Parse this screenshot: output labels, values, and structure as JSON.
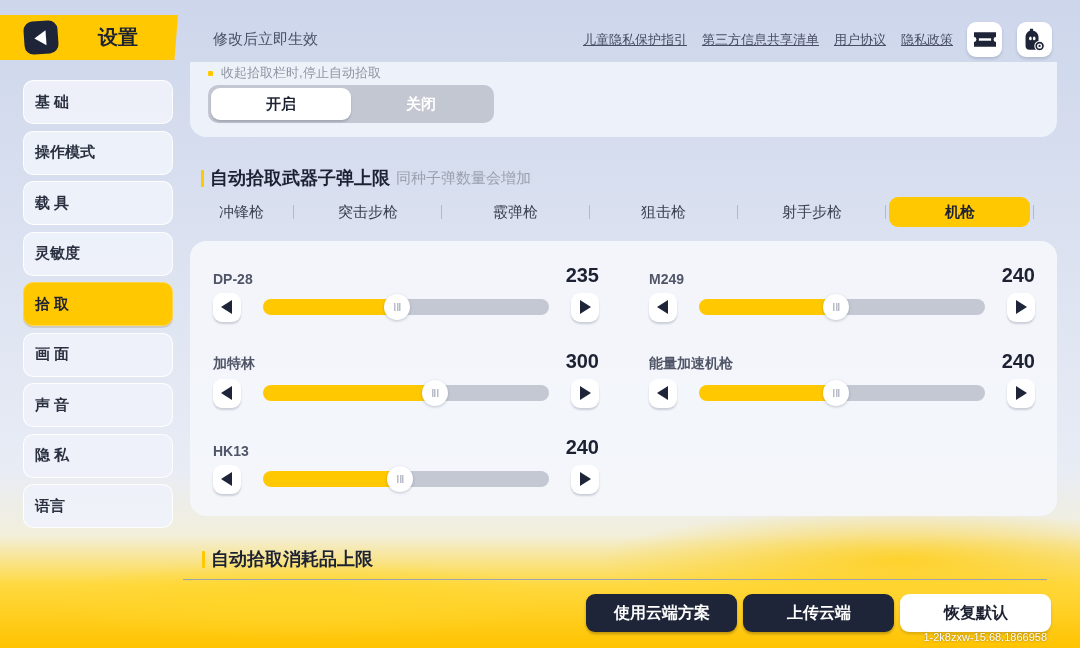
{
  "header": {
    "title": "设置",
    "notice": "修改后立即生效",
    "links": [
      "儿童隐私保护指引",
      "第三方信息共享清单",
      "用户协议",
      "隐私政策"
    ]
  },
  "sidebar": {
    "items": [
      {
        "label": "基 础",
        "selected": false
      },
      {
        "label": "操作模式",
        "selected": false
      },
      {
        "label": "载 具",
        "selected": false
      },
      {
        "label": "灵敏度",
        "selected": false
      },
      {
        "label": "拾 取",
        "selected": true
      },
      {
        "label": "画 面",
        "selected": false
      },
      {
        "label": "声 音",
        "selected": false
      },
      {
        "label": "隐 私",
        "selected": false
      },
      {
        "label": "语言",
        "selected": false
      }
    ]
  },
  "pickup_panel": {
    "note": "收起拾取栏时,停止自动拾取",
    "toggle": [
      {
        "label": "开启",
        "selected": true
      },
      {
        "label": "关闭",
        "selected": false
      }
    ]
  },
  "ammo_section": {
    "title": "自动拾取武器子弹上限",
    "hint": "同种子弹数量会增加",
    "tabs": [
      {
        "label": "冲锋枪",
        "selected": false
      },
      {
        "label": "突击步枪",
        "selected": false
      },
      {
        "label": "霰弹枪",
        "selected": false
      },
      {
        "label": "狙击枪",
        "selected": false
      },
      {
        "label": "射手步枪",
        "selected": false
      },
      {
        "label": "机枪",
        "selected": true
      }
    ],
    "sliders": [
      {
        "name": "DP-28",
        "value": "235",
        "level": 0.47
      },
      {
        "name": "M249",
        "value": "240",
        "level": 0.48
      },
      {
        "name": "加特林",
        "value": "300",
        "level": 0.6
      },
      {
        "name": "能量加速机枪",
        "value": "240",
        "level": 0.48
      },
      {
        "name": "HK13",
        "value": "240",
        "level": 0.48
      }
    ]
  },
  "consumables_section": {
    "title": "自动拾取消耗品上限"
  },
  "buttons": [
    {
      "label": "使用云端方案",
      "kind": "dark"
    },
    {
      "label": "上传云端",
      "kind": "dark"
    },
    {
      "label": "恢复默认",
      "kind": "light"
    }
  ],
  "build_version": "1-2k8zxw-15.68.1866958"
}
